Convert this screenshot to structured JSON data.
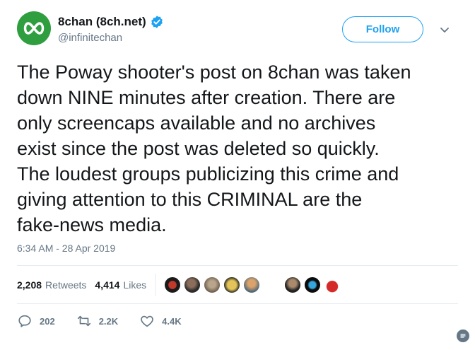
{
  "user": {
    "display_name": "8chan (8ch.net)",
    "handle": "@infinitechan",
    "verified": true,
    "avatar_color": "#2e9e3f"
  },
  "follow_button": {
    "label": "Follow"
  },
  "tweet": {
    "lines": [
      "The Poway shooter's post on 8chan was taken",
      "down NINE minutes after creation. There are",
      "only screencaps available and no archives",
      "exist since the post was deleted so quickly.",
      "The loudest groups publicizing this crime and",
      "giving attention to this CRIMINAL are the",
      "fake-news media."
    ],
    "timestamp": "6:34 AM - 28 Apr 2019"
  },
  "stats": {
    "retweets_count": "2,208",
    "retweets_label": "Retweets",
    "likes_count": "4,414",
    "likes_label": "Likes"
  },
  "actions": {
    "replies": "202",
    "retweets": "2.2K",
    "likes": "4.4K"
  },
  "colors": {
    "accent": "#1da1f2",
    "muted": "#657786",
    "text": "#14171a"
  }
}
